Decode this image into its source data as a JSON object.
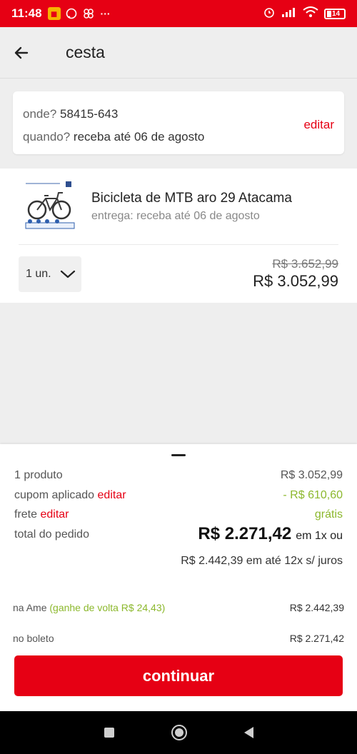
{
  "status_bar": {
    "time": "11:48",
    "battery": "14",
    "icons": [
      "notification-icon",
      "whatsapp-icon",
      "app-icon",
      "more-icon",
      "alarm-icon",
      "signal-icon",
      "wifi-icon",
      "battery-icon"
    ]
  },
  "header": {
    "title": "cesta"
  },
  "location": {
    "where_label": "onde?",
    "where_value": "58415-643",
    "when_label": "quando?",
    "when_value": "receba até 06 de agosto",
    "edit_label": "editar"
  },
  "product": {
    "name": "Bicicleta de MTB aro 29 Atacama",
    "delivery": "entrega: receba até 06 de agosto",
    "quantity": "1 un.",
    "old_price": "R$ 3.652,99",
    "price": "R$ 3.052,99"
  },
  "summary": {
    "products_label": "1 produto",
    "products_value": "R$ 3.052,99",
    "coupon_label": "cupom aplicado",
    "coupon_edit": "editar",
    "coupon_value": "- R$ 610,60",
    "shipping_label": "frete",
    "shipping_edit": "editar",
    "shipping_value": "grátis",
    "total_label": "total do pedido",
    "total_value": "R$ 2.271,42",
    "total_suffix": "em 1x ou",
    "installment": "R$ 2.442,39 em até 12x s/ juros"
  },
  "payments": {
    "ame_label": "na Ame",
    "ame_cashback": "(ganhe de volta R$ 24,43)",
    "ame_value": "R$ 2.442,39",
    "boleto_label": "no boleto",
    "boleto_value": "R$ 2.271,42"
  },
  "continue_label": "continuar",
  "colors": {
    "brand_red": "#e60014",
    "green": "#8cb82d"
  }
}
